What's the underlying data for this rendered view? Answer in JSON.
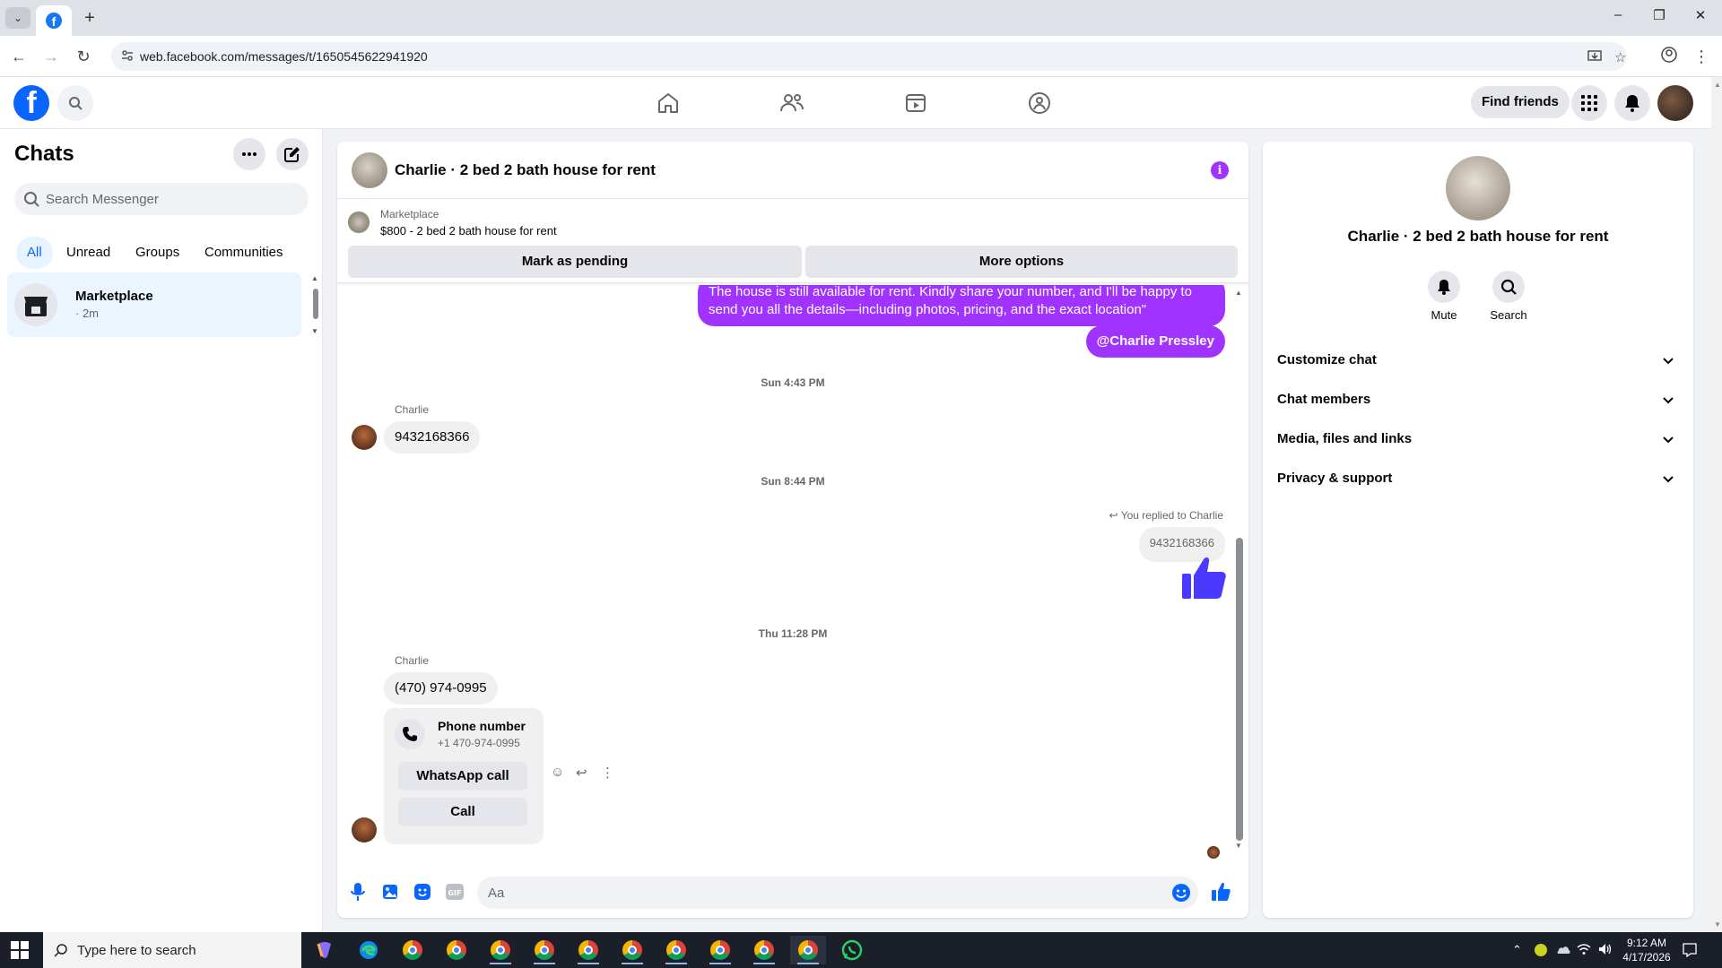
{
  "browser": {
    "url": "web.facebook.com/messages/t/1650545622941920",
    "new_tab_glyph": "+",
    "window_controls": [
      "–",
      "❐",
      "✕"
    ]
  },
  "header": {
    "find_friends": "Find friends",
    "nav_icons": [
      "home-icon",
      "friends-icon",
      "watch-icon",
      "groups-icon"
    ]
  },
  "sidebar": {
    "title": "Chats",
    "search_placeholder": "Search Messenger",
    "filters": [
      {
        "label": "All",
        "active": true
      },
      {
        "label": "Unread",
        "active": false
      },
      {
        "label": "Groups",
        "active": false
      },
      {
        "label": "Communities",
        "active": false
      }
    ],
    "conversations": [
      {
        "name": "Marketplace",
        "time": "· 2m"
      }
    ]
  },
  "chat": {
    "title": "Charlie · 2 bed 2 bath house for rent",
    "marketplace_label": "Marketplace",
    "listing": "$800 - 2 bed 2 bath house for rent",
    "mark_pending": "Mark as pending",
    "more_options": "More options",
    "messages": {
      "out_1_line1": "The house is still available for rent. Kindly share your number, and I'll be happy to",
      "out_1_line2": "send you all the details—including photos, pricing, and the exact location\"",
      "mention": "@Charlie Pressley",
      "ts_1": "Sun 4:43 PM",
      "sender_1": "Charlie",
      "in_1": "9432168366",
      "ts_2": "Sun 8:44 PM",
      "replied_label": "You replied to Charlie",
      "quoted": "9432168366",
      "ts_3": "Thu 11:28 PM",
      "sender_2": "Charlie",
      "in_2": "(470) 974-0995",
      "card_title": "Phone number",
      "card_sub": "+1 470-974-0995",
      "whatsapp_call": "WhatsApp call",
      "call": "Call"
    },
    "composer_placeholder": "Aa",
    "colors": {
      "outgoing": "#a033ff",
      "accent": "#0866ff"
    }
  },
  "info_panel": {
    "name": "Charlie · 2 bed 2 bath house for rent",
    "mute": "Mute",
    "search": "Search",
    "sections": [
      "Customize chat",
      "Chat members",
      "Media, files and links",
      "Privacy & support"
    ]
  },
  "taskbar": {
    "search_placeholder": "Type here to search",
    "time": "9:12 AM",
    "date": "4/17/2026"
  }
}
